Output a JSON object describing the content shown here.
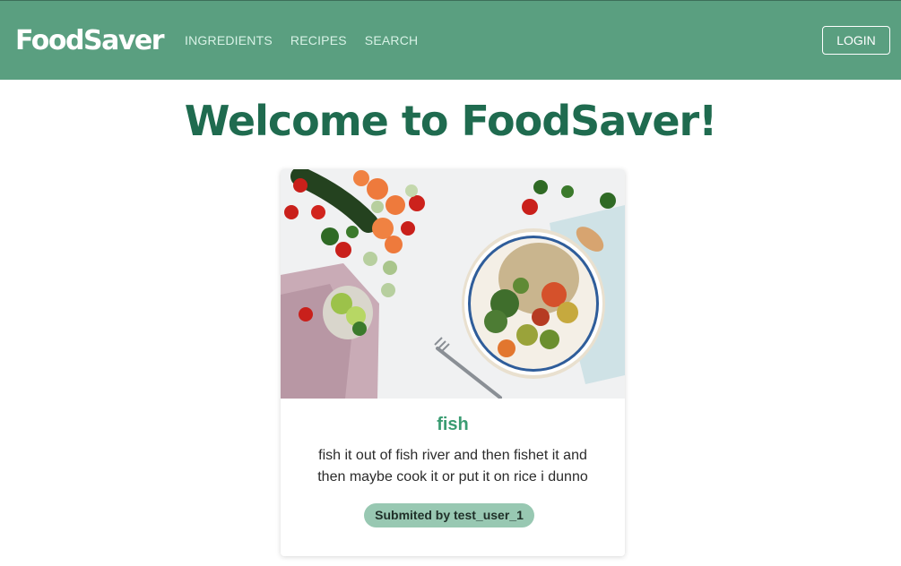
{
  "nav": {
    "brand": "FoodSaver",
    "links": [
      "INGREDIENTS",
      "RECIPES",
      "SEARCH"
    ],
    "login_label": "LOGIN"
  },
  "main": {
    "title": "Welcome to FoodSaver!"
  },
  "card": {
    "image_icon": "food-bowl-photo",
    "title": "fish",
    "description": "fish it out of fish river and then fishet it and then maybe cook it or put it on rice i dunno",
    "badge": "Submited by test_user_1"
  },
  "colors": {
    "navbar": "#5a9f80",
    "title": "#1f6b4f",
    "card_title": "#3a9c72",
    "badge_bg": "#98c8b2"
  }
}
